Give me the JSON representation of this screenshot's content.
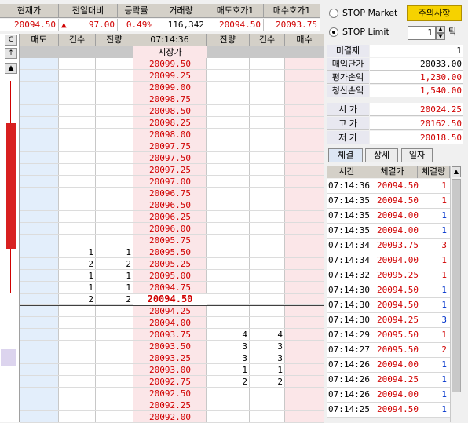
{
  "quote": {
    "headers": [
      "현재가",
      "전일대비",
      "등락률",
      "거래량",
      "매도호가1",
      "매수호가1"
    ],
    "current_price": "20094.50",
    "change_arrow": "▲",
    "change": "97.00",
    "change_rate": "0.49%",
    "volume": "116,342",
    "ask1": "20094.50",
    "bid1": "20093.75"
  },
  "grid": {
    "headers": [
      "매도",
      "건수",
      "잔량",
      "07:14:36",
      "잔량",
      "건수",
      "매수"
    ],
    "side_buttons": [
      "C",
      "↑",
      "▲"
    ],
    "open_label": "시장가",
    "prices": [
      "20099.50",
      "20099.25",
      "20099.00",
      "20098.75",
      "20098.50",
      "20098.25",
      "20098.00",
      "20097.75",
      "20097.50",
      "20097.25",
      "20097.00",
      "20096.75",
      "20096.50",
      "20096.25",
      "20096.00",
      "20095.75",
      "20095.50",
      "20095.25",
      "20095.00",
      "20094.75",
      "20094.50",
      "20094.25",
      "20094.00",
      "20093.75",
      "20093.50",
      "20093.25",
      "20093.00",
      "20092.75",
      "20092.50",
      "20092.25",
      "20092.00"
    ],
    "current_price": "20094.50",
    "ask_counts": [
      "1",
      "2",
      "1",
      "1",
      "2"
    ],
    "ask_sizes": [
      "1",
      "2",
      "1",
      "1",
      "2"
    ],
    "bid_sizes": [
      "4",
      "3",
      "3",
      "1",
      "2"
    ],
    "bid_counts": [
      "4",
      "3",
      "3",
      "1",
      "2"
    ]
  },
  "stop": {
    "market_label": "STOP Market",
    "limit_label": "STOP Limit",
    "caution_button": "주의사항",
    "tick_value": "1",
    "tick_label": "틱"
  },
  "account": [
    {
      "label": "미결제",
      "value": "1",
      "color": "black"
    },
    {
      "label": "매입단가",
      "value": "20033.00",
      "color": "black"
    },
    {
      "label": "평가손익",
      "value": "1,230.00",
      "color": "red"
    },
    {
      "label": "청산손익",
      "value": "1,540.00",
      "color": "red"
    }
  ],
  "ohlc": [
    {
      "label": "시 가",
      "value": "20024.25"
    },
    {
      "label": "고 가",
      "value": "20162.50"
    },
    {
      "label": "저 가",
      "value": "20018.50"
    }
  ],
  "tabs": [
    "체결",
    "상세",
    "일자"
  ],
  "trades": {
    "headers": [
      "시간",
      "체결가",
      "체결량"
    ],
    "rows": [
      {
        "time": "07:14:36",
        "price": "20094.50",
        "qty": "1",
        "side": "buy"
      },
      {
        "time": "07:14:35",
        "price": "20094.50",
        "qty": "1",
        "side": "buy"
      },
      {
        "time": "07:14:35",
        "price": "20094.00",
        "qty": "1",
        "side": "sell"
      },
      {
        "time": "07:14:35",
        "price": "20094.00",
        "qty": "1",
        "side": "sell"
      },
      {
        "time": "07:14:34",
        "price": "20093.75",
        "qty": "3",
        "side": "buy"
      },
      {
        "time": "07:14:34",
        "price": "20094.00",
        "qty": "1",
        "side": "buy"
      },
      {
        "time": "07:14:32",
        "price": "20095.25",
        "qty": "1",
        "side": "buy"
      },
      {
        "time": "07:14:30",
        "price": "20094.50",
        "qty": "1",
        "side": "sell"
      },
      {
        "time": "07:14:30",
        "price": "20094.50",
        "qty": "1",
        "side": "sell"
      },
      {
        "time": "07:14:30",
        "price": "20094.25",
        "qty": "3",
        "side": "sell"
      },
      {
        "time": "07:14:29",
        "price": "20095.50",
        "qty": "1",
        "side": "buy"
      },
      {
        "time": "07:14:27",
        "price": "20095.50",
        "qty": "2",
        "side": "buy"
      },
      {
        "time": "07:14:26",
        "price": "20094.00",
        "qty": "1",
        "side": "sell"
      },
      {
        "time": "07:14:26",
        "price": "20094.25",
        "qty": "1",
        "side": "sell"
      },
      {
        "time": "07:14:26",
        "price": "20094.00",
        "qty": "1",
        "side": "sell"
      },
      {
        "time": "07:14:25",
        "price": "20094.50",
        "qty": "1",
        "side": "sell"
      }
    ]
  },
  "colors": {
    "up": "#d00000",
    "down": "#0033cc",
    "ask_bg": "#e3eefb",
    "bid_bg": "#fbe6e8",
    "price_bg": "#fbe6e8",
    "caution_bg": "#f6d200"
  }
}
